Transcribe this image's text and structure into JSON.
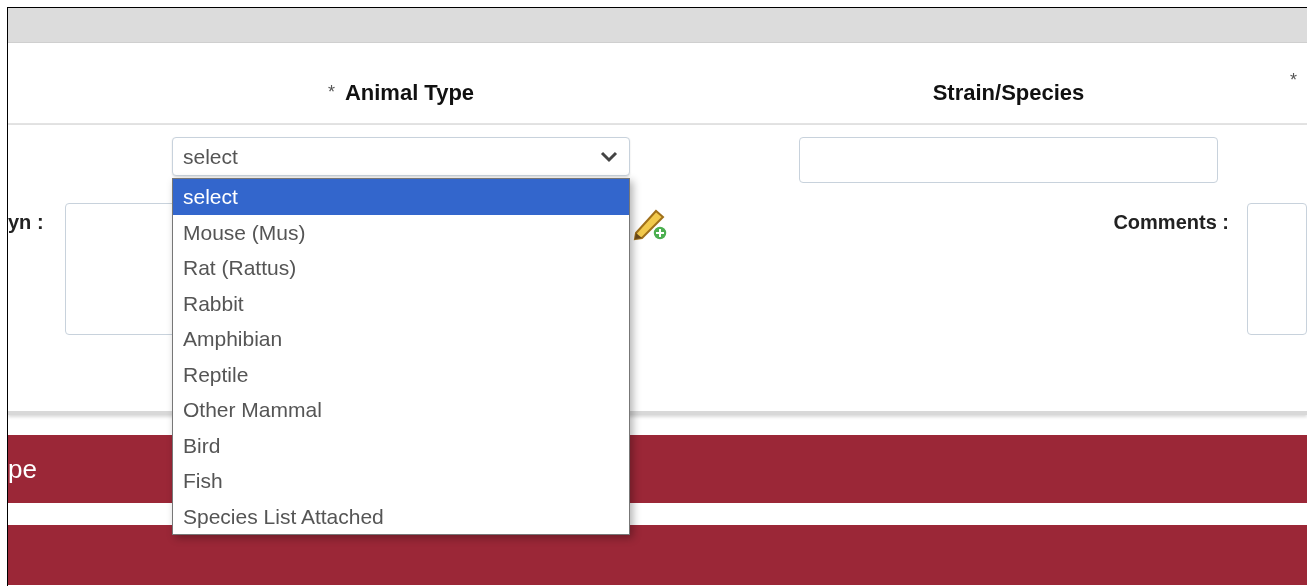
{
  "header_columns": [
    {
      "mark": "*",
      "label": "Animal Type"
    },
    {
      "label": "Strain/Species"
    },
    {
      "mark": "*"
    }
  ],
  "form": {
    "animal_type_select": {
      "value": "select",
      "expanded": true,
      "options": [
        {
          "label": "select",
          "selected": true
        },
        {
          "label": "Mouse (Mus)",
          "selected": false
        },
        {
          "label": "Rat (Rattus)",
          "selected": false
        },
        {
          "label": "Rabbit",
          "selected": false
        },
        {
          "label": "Amphibian",
          "selected": false
        },
        {
          "label": "Reptile",
          "selected": false
        },
        {
          "label": "Other Mammal",
          "selected": false
        },
        {
          "label": "Bird",
          "selected": false
        },
        {
          "label": "Fish",
          "selected": false
        },
        {
          "label": "Species List Attached",
          "selected": false
        }
      ]
    },
    "strain_species_field": {
      "kind": "text-input"
    },
    "left_label": "yn :",
    "comments_label": "Comments :"
  },
  "section_bars": [
    {
      "label": "pe"
    }
  ]
}
